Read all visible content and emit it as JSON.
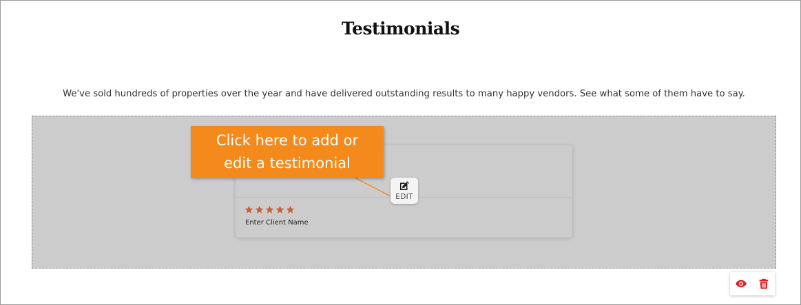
{
  "section": {
    "title": "Testimonials",
    "description": "We've sold hundreds of properties over the year and have delivered outstanding results to many happy vendors. See what some of them have to say."
  },
  "testimonial_card": {
    "rating": 5,
    "rating_max": 5,
    "star_color": "#c8613a",
    "client_name": "Enter Client Name"
  },
  "edit_button": {
    "label": "EDIT",
    "icon": "edit-icon"
  },
  "callout": {
    "line1": "Click here to add or",
    "line2": "edit a testimonial",
    "color": "#f48a1b"
  },
  "actions": {
    "preview_icon": "eye-icon",
    "delete_icon": "trash-icon",
    "color": "#e01b1b"
  }
}
